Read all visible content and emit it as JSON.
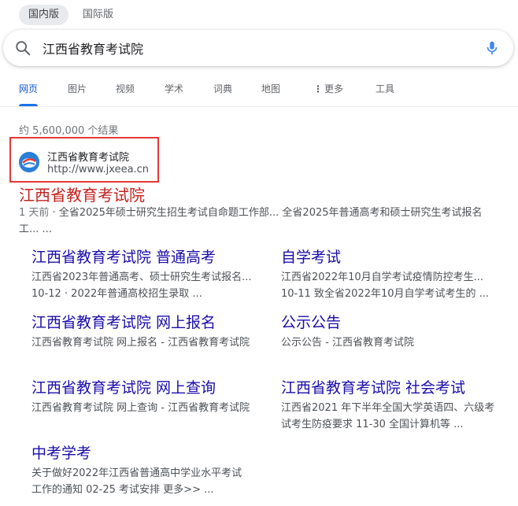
{
  "region": {
    "options": [
      "国内版",
      "国际版"
    ],
    "active": "国内版"
  },
  "search": {
    "query": "江西省教育考试院"
  },
  "tabs": [
    {
      "label": "网页",
      "active": true
    },
    {
      "label": "图片"
    },
    {
      "label": "视频"
    },
    {
      "label": "学术"
    },
    {
      "label": "词典"
    },
    {
      "label": "地图"
    },
    {
      "label": "更多"
    },
    {
      "label": "工具"
    }
  ],
  "stats": "约 5,600,000 个结果",
  "site": {
    "name": "江西省教育考试院",
    "url": "http://www.jxeea.cn"
  },
  "result": {
    "title": "江西省教育考试院",
    "date": "1 天前",
    "snippet": " · 全省2025年硕士研究生招生考试自命题工作部... 全省2025年普通高考和硕士研究生考试报名工... ..."
  },
  "sitelinks": [
    {
      "title": "江西省教育考试院 普通高考",
      "desc": "江西省2023年普通高考、硕士研究生考试报名... 10-12 · 2022年普通高校招生录取 ..."
    },
    {
      "title": "自学考试",
      "desc": "江西省2022年10月自学考试疫情防控考生... 10-11 致全省2022年10月自学考试考生的 ..."
    },
    {
      "title": "江西省教育考试院 网上报名",
      "desc": "江西省教育考试院 网上报名 - 江西省教育考试院"
    },
    {
      "title": "公示公告",
      "desc": "公示公告 - 江西省教育考试院"
    },
    {
      "title": "江西省教育考试院 网上查询",
      "desc": "江西省教育考试院 网上查询 - 江西省教育考试院"
    },
    {
      "title": "江西省教育考试院 社会考试",
      "desc": "江西省2021 年下半年全国大学英语四、六级考试考生防疫要求 11-30 全国计算机等 ..."
    },
    {
      "title": "中考学考",
      "desc": "关于做好2022年江西省普通高中学业水平考试 工作的通知 02-25 考试安排 更多>> ..."
    }
  ],
  "colors": {
    "accent": "#1a73e8",
    "link": "#1a0dab",
    "main_title": "#c5221f",
    "highlight_box": "#e53935"
  },
  "icons": {
    "search": "search-icon",
    "mic": "microphone-icon",
    "more": "more-vert-icon",
    "favicon": "site-logo-icon"
  }
}
